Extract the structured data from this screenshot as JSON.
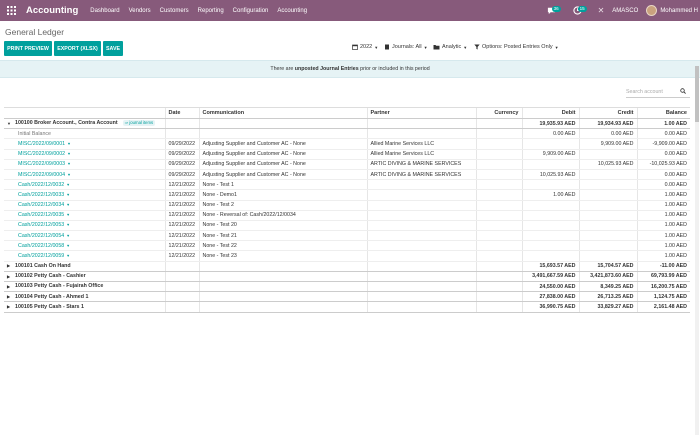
{
  "navbar": {
    "brand": "Accounting",
    "menu": [
      "Dashboard",
      "Vendors",
      "Customers",
      "Reporting",
      "Configuration",
      "Accounting"
    ],
    "chat_badge": "36",
    "activity_badge": "15",
    "company": "AMASCO",
    "user": "Mohammed H"
  },
  "control": {
    "title": "General Ledger",
    "buttons": [
      "PRINT PREVIEW",
      "EXPORT (XLSX)",
      "SAVE"
    ],
    "filters": [
      "2022",
      "Journals: All",
      "Analytic",
      "Options: Posted Entries Only"
    ]
  },
  "warning": {
    "pre": "There are",
    "bold": "unposted Journal Entries",
    "post": "prior or included in this period"
  },
  "search": {
    "placeholder": "Search account"
  },
  "table": {
    "columns": [
      "",
      "Date",
      "Communication",
      "Partner",
      "Currency",
      "Debit",
      "Credit",
      "Balance"
    ],
    "main_account": {
      "name": "100100 Broker Account., Contra Account",
      "tag": "⇒ journal items",
      "debit": "19,935.93 AED",
      "credit": "19,934.93 AED",
      "balance": "1.00 AED"
    },
    "initial_balance": {
      "label": "Initial Balance",
      "debit": "0.00 AED",
      "credit": "0.00 AED",
      "balance": "0.00 AED"
    },
    "lines": [
      {
        "ref": "MISC/2022/09/0001",
        "date": "09/29/2022",
        "comm": "Adjusting Supplier and Customer AC - None",
        "partner": "Allied Marine Services LLC",
        "debit": "",
        "credit": "9,909.00 AED",
        "balance": "-9,909.00 AED"
      },
      {
        "ref": "MISC/2022/09/0002",
        "date": "09/29/2022",
        "comm": "Adjusting Supplier and Customer AC - None",
        "partner": "Allied Marine Services LLC",
        "debit": "9,909.00 AED",
        "credit": "",
        "balance": "0.00 AED"
      },
      {
        "ref": "MISC/2022/09/0003",
        "date": "09/29/2022",
        "comm": "Adjusting Supplier and Customer AC - None",
        "partner": "ARTIC DIVING & MARINE SERVICES",
        "debit": "",
        "credit": "10,025.93 AED",
        "balance": "-10,025.93 AED"
      },
      {
        "ref": "MISC/2022/09/0004",
        "date": "09/29/2022",
        "comm": "Adjusting Supplier and Customer AC - None",
        "partner": "ARTIC DIVING & MARINE SERVICES",
        "debit": "10,025.93 AED",
        "credit": "",
        "balance": "0.00 AED"
      },
      {
        "ref": "Cash/2022/12/0032",
        "date": "12/21/2022",
        "comm": "None - Test 1",
        "partner": "",
        "debit": "",
        "credit": "",
        "balance": "0.00 AED"
      },
      {
        "ref": "Cash/2022/12/0033",
        "date": "12/21/2022",
        "comm": "None - Demo1",
        "partner": "",
        "debit": "1.00 AED",
        "credit": "",
        "balance": "1.00 AED"
      },
      {
        "ref": "Cash/2022/12/0034",
        "date": "12/21/2022",
        "comm": "None - Test 2",
        "partner": "",
        "debit": "",
        "credit": "",
        "balance": "1.00 AED"
      },
      {
        "ref": "Cash/2022/12/0035",
        "date": "12/21/2022",
        "comm": "None - Reversal of: Cash/2022/12/0034",
        "partner": "",
        "debit": "",
        "credit": "",
        "balance": "1.00 AED"
      },
      {
        "ref": "Cash/2022/12/0053",
        "date": "12/21/2022",
        "comm": "None - Test 20",
        "partner": "",
        "debit": "",
        "credit": "",
        "balance": "1.00 AED"
      },
      {
        "ref": "Cash/2022/12/0054",
        "date": "12/21/2022",
        "comm": "None - Test 21",
        "partner": "",
        "debit": "",
        "credit": "",
        "balance": "1.00 AED"
      },
      {
        "ref": "Cash/2022/12/0058",
        "date": "12/21/2022",
        "comm": "None - Test 22",
        "partner": "",
        "debit": "",
        "credit": "",
        "balance": "1.00 AED"
      },
      {
        "ref": "Cash/2022/12/0059",
        "date": "12/21/2022",
        "comm": "None - Test 23",
        "partner": "",
        "debit": "",
        "credit": "",
        "balance": "1.00 AED"
      }
    ],
    "other_accounts": [
      {
        "name": "100101 Cash On Hand",
        "debit": "15,693.57 AED",
        "credit": "15,704.57 AED",
        "balance": "-11.00 AED"
      },
      {
        "name": "100102 Petty Cash - Cashier",
        "debit": "3,491,667.59 AED",
        "credit": "3,421,873.60 AED",
        "balance": "69,793.99 AED"
      },
      {
        "name": "100103 Petty Cash - Fujairah Office",
        "debit": "24,550.00 AED",
        "credit": "8,349.25 AED",
        "balance": "16,200.75 AED"
      },
      {
        "name": "100104 Petty Cash - Ahmed 1",
        "debit": "27,838.00 AED",
        "credit": "26,713.25 AED",
        "balance": "1,124.75 AED"
      },
      {
        "name": "100105 Petty Cash - Stars 1",
        "debit": "36,990.75 AED",
        "credit": "33,829.27 AED",
        "balance": "2,161.48 AED"
      }
    ]
  }
}
